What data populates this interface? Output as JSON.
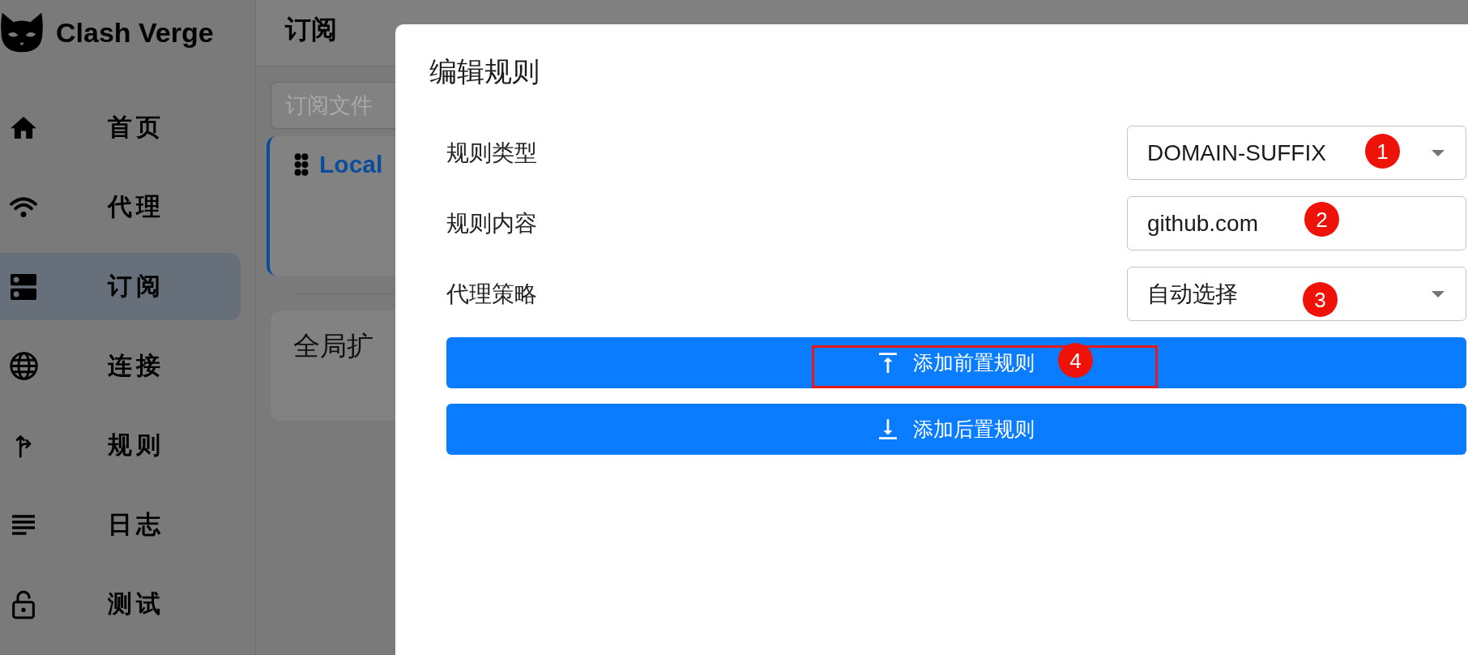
{
  "sidebar": {
    "app_name": "Clash Verge",
    "items": [
      {
        "label": "首页",
        "selected": false
      },
      {
        "label": "代理",
        "selected": false
      },
      {
        "label": "订阅",
        "selected": true
      },
      {
        "label": "连接",
        "selected": false
      },
      {
        "label": "规则",
        "selected": false
      },
      {
        "label": "日志",
        "selected": false
      },
      {
        "label": "测试",
        "selected": false
      }
    ]
  },
  "page": {
    "title": "订阅",
    "search": {
      "placeholder": "订阅文件"
    },
    "profiles": [
      {
        "name": "Local",
        "selected": true
      }
    ],
    "extension_card": {
      "title": "全局扩"
    }
  },
  "dialog": {
    "title": "编辑规则",
    "fields": [
      {
        "label": "规则类型",
        "kind": "select",
        "value": "DOMAIN-SUFFIX",
        "marker": "1"
      },
      {
        "label": "规则内容",
        "kind": "text",
        "value": "github.com",
        "marker": "2"
      },
      {
        "label": "代理策略",
        "kind": "select",
        "value": "自动选择",
        "marker": "3"
      }
    ],
    "buttons": [
      {
        "label": "添加前置规则",
        "kind": "prepend",
        "marker": "4",
        "highlighted": true
      },
      {
        "label": "添加后置规则",
        "kind": "append",
        "highlighted": false
      }
    ]
  }
}
